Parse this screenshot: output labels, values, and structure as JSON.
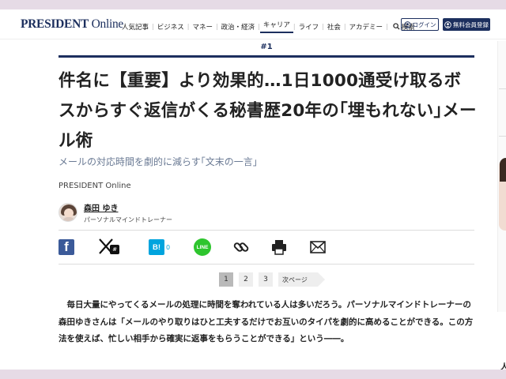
{
  "header": {
    "logo_bold": "PRESIDENT",
    "logo_online": " Online",
    "nav": [
      {
        "label": "人気記事",
        "name": "nav-popular"
      },
      {
        "label": "ビジネス",
        "name": "nav-business"
      },
      {
        "label": "マネー",
        "name": "nav-money"
      },
      {
        "label": "政治・経済",
        "name": "nav-politics-economy"
      },
      {
        "label": "キャリア",
        "name": "nav-career"
      },
      {
        "label": "ライフ",
        "name": "nav-life"
      },
      {
        "label": "社会",
        "name": "nav-society"
      },
      {
        "label": "アカデミー",
        "name": "nav-academy"
      }
    ],
    "active_nav": "キャリア",
    "search_label": "検索",
    "login_label": "ログイン",
    "signup_label": "無料会員登録"
  },
  "article": {
    "issue": "#1",
    "title": "件名に【重要】より効果的…1日1000通受け取るボスからすぐ返信がくる秘書歴20年の｢埋もれない｣メール術",
    "subtitle": "メールの対応時間を劇的に減らす｢文末の一言｣",
    "source": "PRESIDENT Online",
    "author_name": "森田 ゆき",
    "author_role": "パーソナルマインドトレーナー",
    "hatebu_count": "0",
    "pages": [
      "1",
      "2",
      "3"
    ],
    "current_page": "1",
    "next_label": "次ページ",
    "body": "毎日大量にやってくるメールの処理に時間を奪われている人は多いだろう。パーソナルマインドトレーナーの森田ゆきさんは「メールのやり取りはひと工夫するだけでお互いのタイパを劇的に高めることができる。この方法を使えば、忙しい相手から確実に返事をもらうことができる」という――。",
    "stray_text": "人"
  },
  "share": {
    "icons": [
      "facebook-icon",
      "x-icon",
      "hatebu-icon",
      "line-icon",
      "link-icon",
      "print-icon",
      "mail-icon"
    ],
    "x_badge": "#",
    "hatebu_glyph": "B!",
    "line_glyph": "LINE"
  },
  "colors": {
    "brand": "#1c2f5e",
    "facebook": "#3b5a99",
    "hatebu": "#00a4de",
    "line": "#2ec52e",
    "band": "#e6dbe6"
  }
}
